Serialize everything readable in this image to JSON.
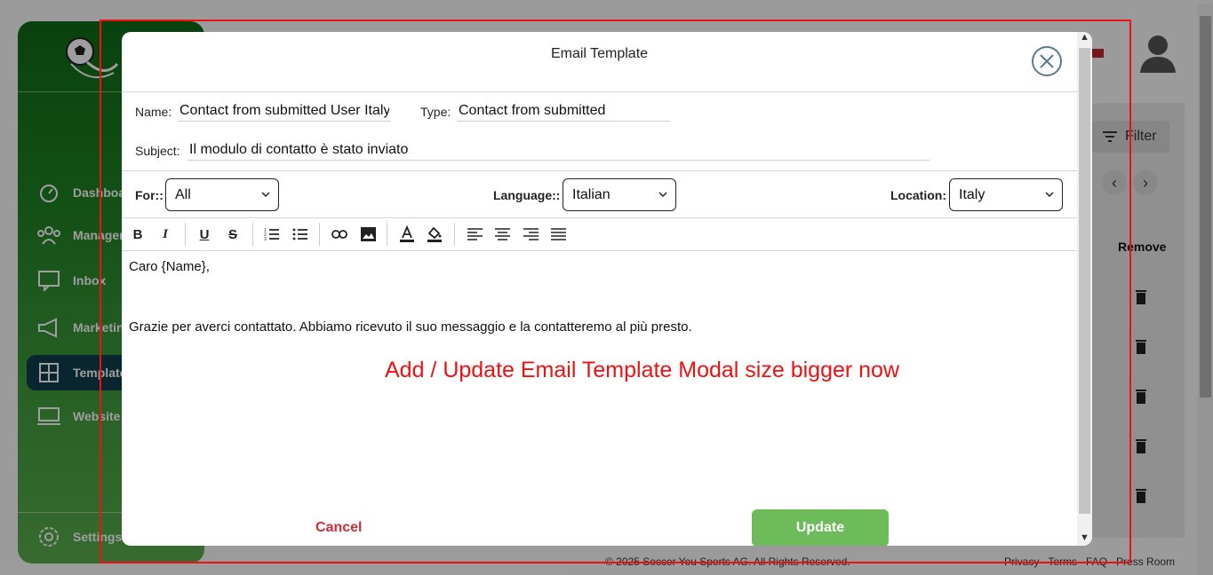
{
  "modal": {
    "title": "Email Template",
    "name_label": "Name:",
    "name_value": "Contact from submitted User Italy",
    "type_label": "Type:",
    "type_value": "Contact from submitted",
    "subject_label": "Subject:",
    "subject_value": "Il modulo di contatto è stato inviato",
    "for_label": "For::",
    "for_value": "All",
    "language_label": "Language::",
    "language_value": "Italian",
    "location_label": "Location:",
    "location_value": "Italy",
    "body_line1": "Caro {Name},",
    "body_line2": "Grazie per averci contattato. Abbiamo ricevuto il suo messaggio e la contatteremo al più presto.",
    "annotation": "Add / Update Email Template Modal size bigger now",
    "cancel_label": "Cancel",
    "update_label": "Update"
  },
  "toolbar": {
    "icons": [
      "bold-icon",
      "italic-icon",
      "underline-icon",
      "strikethrough-icon",
      "ordered-list-icon",
      "bullet-list-icon",
      "link-icon",
      "image-icon",
      "text-color-icon",
      "highlight-color-icon",
      "align-left-icon",
      "align-center-icon",
      "align-right-icon",
      "align-justify-icon"
    ]
  },
  "sidebar": {
    "items": [
      {
        "label": "Dashboard",
        "icon": "dashboard-icon"
      },
      {
        "label": "Management",
        "icon": "users-icon"
      },
      {
        "label": "Inbox",
        "icon": "inbox-icon"
      },
      {
        "label": "Marketing",
        "icon": "megaphone-icon"
      },
      {
        "label": "Templates",
        "icon": "templates-icon"
      },
      {
        "label": "Website",
        "icon": "website-icon"
      },
      {
        "label": "Settings",
        "icon": "gear-icon"
      }
    ]
  },
  "content": {
    "filter_label": "Filter",
    "remove_header": "Remove"
  },
  "footer": {
    "copyright": "© 2025 Soccer You Sports AG. All Rights Reserved.",
    "links": [
      "Privacy",
      "Terms",
      "FAQ",
      "Press Room"
    ]
  },
  "colors": {
    "sidebar_green": "#1d7f22",
    "active_nav": "#0e3d4e",
    "update_green": "#6dbb5a",
    "cancel_red": "#d02c3a",
    "annotation_red": "#ee1111"
  }
}
